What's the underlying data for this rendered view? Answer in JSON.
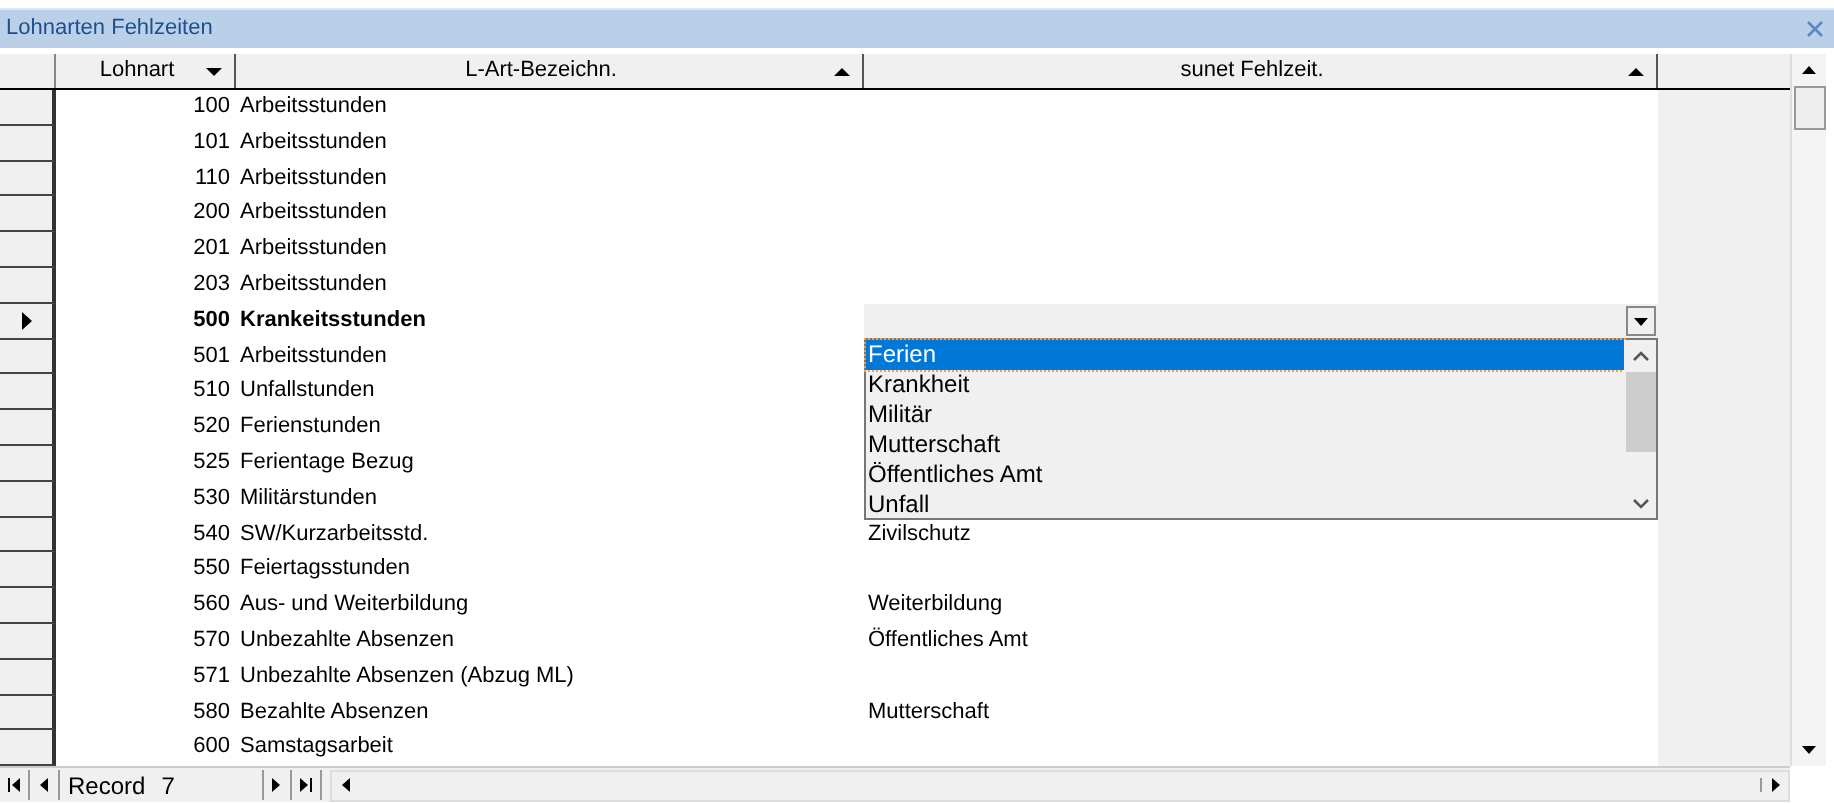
{
  "window": {
    "title": "Lohnarten Fehlzeiten"
  },
  "columns": [
    {
      "label": "Lohnart",
      "ascending": false
    },
    {
      "label": "L-Art-Bezeichn.",
      "ascending": true
    },
    {
      "label": "sunet Fehlzeit.",
      "ascending": true
    }
  ],
  "rows": [
    {
      "lohnart": "100",
      "bezeichnung": "Arbeitsstunden",
      "current": false
    },
    {
      "lohnart": "101",
      "bezeichnung": "Arbeitsstunden",
      "current": false
    },
    {
      "lohnart": "110",
      "bezeichnung": "Arbeitsstunden",
      "current": false
    },
    {
      "lohnart": "200",
      "bezeichnung": "Arbeitsstunden",
      "current": false
    },
    {
      "lohnart": "201",
      "bezeichnung": "Arbeitsstunden",
      "current": false
    },
    {
      "lohnart": "203",
      "bezeichnung": "Arbeitsstunden",
      "current": false
    },
    {
      "lohnart": "500",
      "bezeichnung": "Krankeitsstunden",
      "current": true
    },
    {
      "lohnart": "501",
      "bezeichnung": "Arbeitsstunden",
      "current": false
    },
    {
      "lohnart": "510",
      "bezeichnung": "Unfallstunden",
      "current": false
    },
    {
      "lohnart": "520",
      "bezeichnung": "Ferienstunden",
      "current": false
    },
    {
      "lohnart": "525",
      "bezeichnung": "Ferientage Bezug",
      "current": false
    },
    {
      "lohnart": "530",
      "bezeichnung": "Militärstunden",
      "current": false
    },
    {
      "lohnart": "540",
      "bezeichnung": "SW/Kurzarbeitsstd.",
      "fehlzeit": "Zivilschutz",
      "current": false
    },
    {
      "lohnart": "550",
      "bezeichnung": "Feiertagsstunden",
      "current": false
    },
    {
      "lohnart": "560",
      "bezeichnung": "Aus- und Weiterbildung",
      "fehlzeit": "Weiterbildung",
      "current": false
    },
    {
      "lohnart": "570",
      "bezeichnung": "Unbezahlte Absenzen",
      "fehlzeit": "Öffentliches Amt",
      "current": false
    },
    {
      "lohnart": "571",
      "bezeichnung": "Unbezahlte Absenzen (Abzug ML)",
      "current": false
    },
    {
      "lohnart": "580",
      "bezeichnung": "Bezahlte Absenzen",
      "fehlzeit": "Mutterschaft",
      "current": false
    },
    {
      "lohnart": "600",
      "bezeichnung": "Samstagsarbeit",
      "current": false
    }
  ],
  "dropdown": {
    "items": [
      {
        "label": "Ferien",
        "selected": true
      },
      {
        "label": "Krankheit",
        "selected": false
      },
      {
        "label": "Militär",
        "selected": false
      },
      {
        "label": "Mutterschaft",
        "selected": false
      },
      {
        "label": "Öffentliches Amt",
        "selected": false
      },
      {
        "label": "Unfall",
        "selected": false
      }
    ]
  },
  "navigator": {
    "label": "Record",
    "value": "7"
  }
}
